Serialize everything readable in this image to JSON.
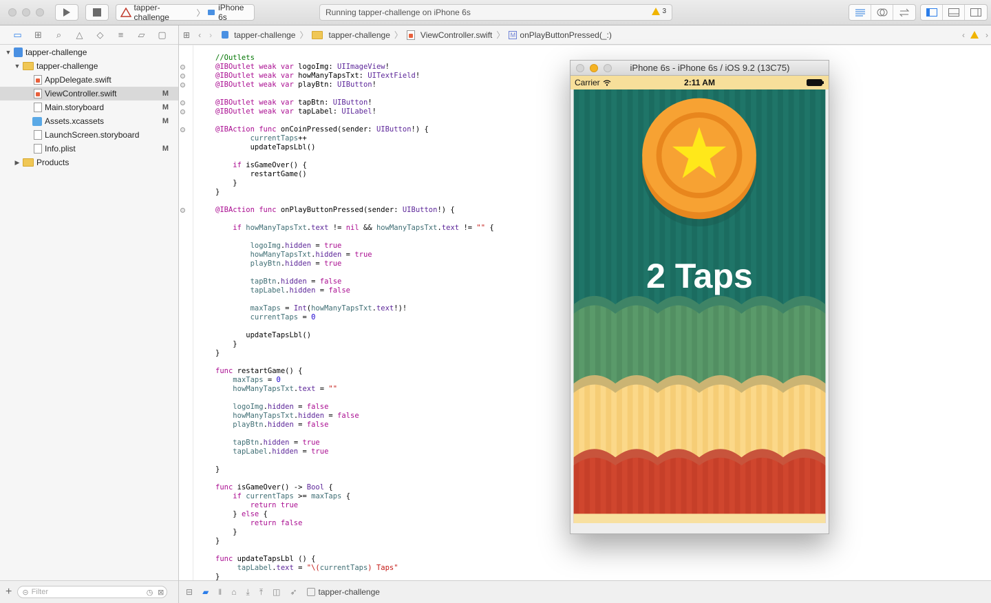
{
  "toolbar": {
    "scheme_project": "tapper-challenge",
    "scheme_device": "iPhone 6s",
    "status_text": "Running tapper-challenge on iPhone 6s",
    "warning_count": "3"
  },
  "navigator": {
    "tree": [
      {
        "label": "tapper-challenge",
        "badge": "",
        "kind": "project"
      },
      {
        "label": "tapper-challenge",
        "badge": "",
        "kind": "folder"
      },
      {
        "label": "AppDelegate.swift",
        "badge": "",
        "kind": "swift"
      },
      {
        "label": "ViewController.swift",
        "badge": "M",
        "kind": "swift"
      },
      {
        "label": "Main.storyboard",
        "badge": "M",
        "kind": "file"
      },
      {
        "label": "Assets.xcassets",
        "badge": "M",
        "kind": "assets"
      },
      {
        "label": "LaunchScreen.storyboard",
        "badge": "",
        "kind": "file"
      },
      {
        "label": "Info.plist",
        "badge": "M",
        "kind": "file"
      },
      {
        "label": "Products",
        "badge": "",
        "kind": "folder"
      }
    ],
    "filter_placeholder": "Filter"
  },
  "jumpbar": {
    "items": [
      "tapper-challenge",
      "tapper-challenge",
      "ViewController.swift",
      "onPlayButtonPressed(_:)"
    ]
  },
  "simulator": {
    "title": "iPhone 6s - iPhone 6s / iOS 9.2 (13C75)",
    "carrier": "Carrier",
    "time": "2:11 AM",
    "taps_label": "2 Taps"
  },
  "debugbar": {
    "target": "tapper-challenge"
  },
  "colors": {
    "accent": "#2b7de9",
    "keyword": "#aa0d91",
    "type": "#5c2699",
    "comment": "#007400",
    "string": "#c41a16",
    "number": "#1c00cf",
    "property": "#3f6e74",
    "coin": "#f7a233",
    "star": "#ffe81a",
    "teal": "#1f7568",
    "green": "#5a9a6a",
    "cream": "#fbd889",
    "red": "#d0462e"
  }
}
